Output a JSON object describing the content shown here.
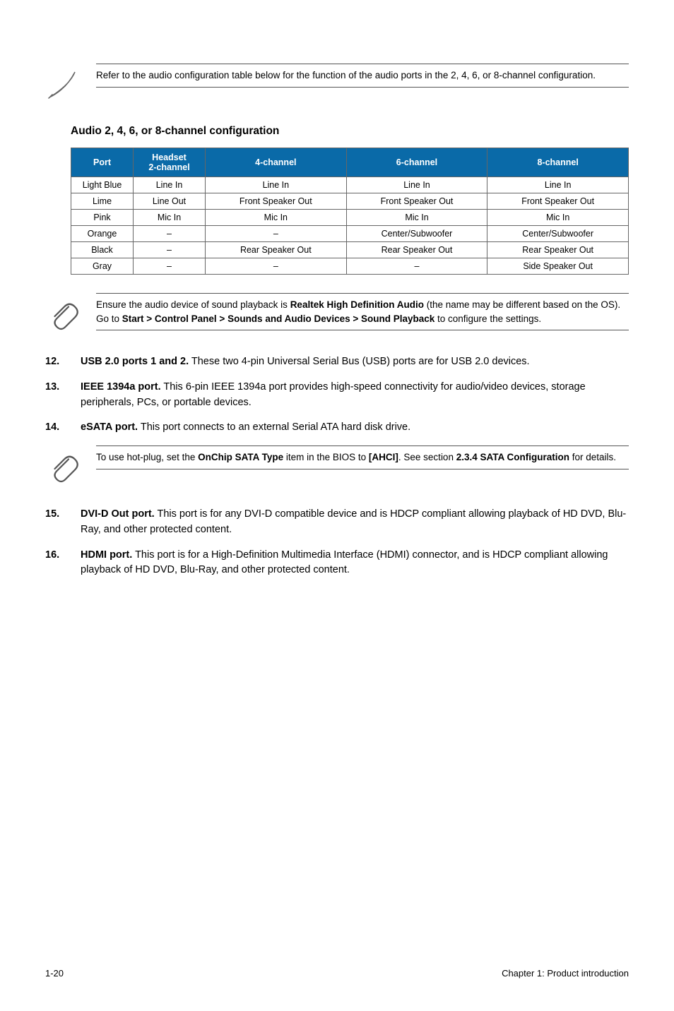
{
  "note1": {
    "text": "Refer to the audio configuration table below for the function of the audio ports in the 2, 4, 6, or 8-channel configuration."
  },
  "section_title": "Audio 2, 4, 6, or 8-channel configuration",
  "table": {
    "headers": {
      "port": "Port",
      "headset": "Headset",
      "headset_sub": "2-channel",
      "ch4": "4-channel",
      "ch6": "6-channel",
      "ch8": "8-channel"
    },
    "rows": [
      {
        "port": "Light Blue",
        "hs": "Line In",
        "c4": "Line In",
        "c6": "Line In",
        "c8": "Line In"
      },
      {
        "port": "Lime",
        "hs": "Line Out",
        "c4": "Front Speaker Out",
        "c6": "Front Speaker Out",
        "c8": "Front Speaker Out"
      },
      {
        "port": "Pink",
        "hs": "Mic In",
        "c4": "Mic In",
        "c6": "Mic In",
        "c8": "Mic In"
      },
      {
        "port": "Orange",
        "hs": "–",
        "c4": "–",
        "c6": "Center/Subwoofer",
        "c8": "Center/Subwoofer"
      },
      {
        "port": "Black",
        "hs": "–",
        "c4": "Rear Speaker Out",
        "c6": "Rear Speaker Out",
        "c8": "Rear Speaker Out"
      },
      {
        "port": "Gray",
        "hs": "–",
        "c4": "–",
        "c6": "–",
        "c8": "Side Speaker Out"
      }
    ]
  },
  "note2": {
    "before": "Ensure the audio device of sound playback is ",
    "b1": "Realtek High Definition Audio",
    "mid1": " (the name may be different based on the OS). Go to ",
    "b2": "Start > Control Panel > Sounds and Audio Devices > Sound Playback",
    "after": " to configure the settings."
  },
  "items": {
    "n12": "12.",
    "t12_b": "USB 2.0 ports 1 and 2.",
    "t12": " These two 4-pin Universal Serial Bus (USB) ports are for USB 2.0 devices.",
    "n13": "13.",
    "t13_b": "IEEE 1394a port.",
    "t13": " This 6-pin IEEE 1394a port provides high-speed connectivity for audio/video devices, storage peripherals, PCs, or portable devices.",
    "n14": "14.",
    "t14_b": "eSATA port.",
    "t14": " This port connects to an external Serial ATA hard disk drive.",
    "n15": "15.",
    "t15_b": "DVI-D Out port.",
    "t15": " This port is for any DVI-D compatible device and is HDCP compliant allowing playback of HD DVD, Blu-Ray, and other protected content.",
    "n16": "16.",
    "t16_b": "HDMI port.",
    "t16": " This port is for a High-Definition Multimedia Interface (HDMI) connector, and is HDCP compliant allowing playback of HD DVD, Blu-Ray, and other protected content."
  },
  "note3": {
    "before": "To use hot-plug, set the ",
    "b1": "OnChip SATA Type",
    "mid1": " item in the BIOS to ",
    "b2": "[AHCI]",
    "mid2": ". See section ",
    "b3": "2.3.4 SATA Configuration",
    "after": " for details."
  },
  "footer": {
    "left": "1-20",
    "right": "Chapter 1: Product introduction"
  },
  "chart_data": {
    "type": "table",
    "title": "Audio 2, 4, 6, or 8-channel configuration",
    "columns": [
      "Port",
      "Headset 2-channel",
      "4-channel",
      "6-channel",
      "8-channel"
    ],
    "rows": [
      [
        "Light Blue",
        "Line In",
        "Line In",
        "Line In",
        "Line In"
      ],
      [
        "Lime",
        "Line Out",
        "Front Speaker Out",
        "Front Speaker Out",
        "Front Speaker Out"
      ],
      [
        "Pink",
        "Mic In",
        "Mic In",
        "Mic In",
        "Mic In"
      ],
      [
        "Orange",
        "–",
        "–",
        "Center/Subwoofer",
        "Center/Subwoofer"
      ],
      [
        "Black",
        "–",
        "Rear Speaker Out",
        "Rear Speaker Out",
        "Rear Speaker Out"
      ],
      [
        "Gray",
        "–",
        "–",
        "–",
        "Side Speaker Out"
      ]
    ]
  }
}
